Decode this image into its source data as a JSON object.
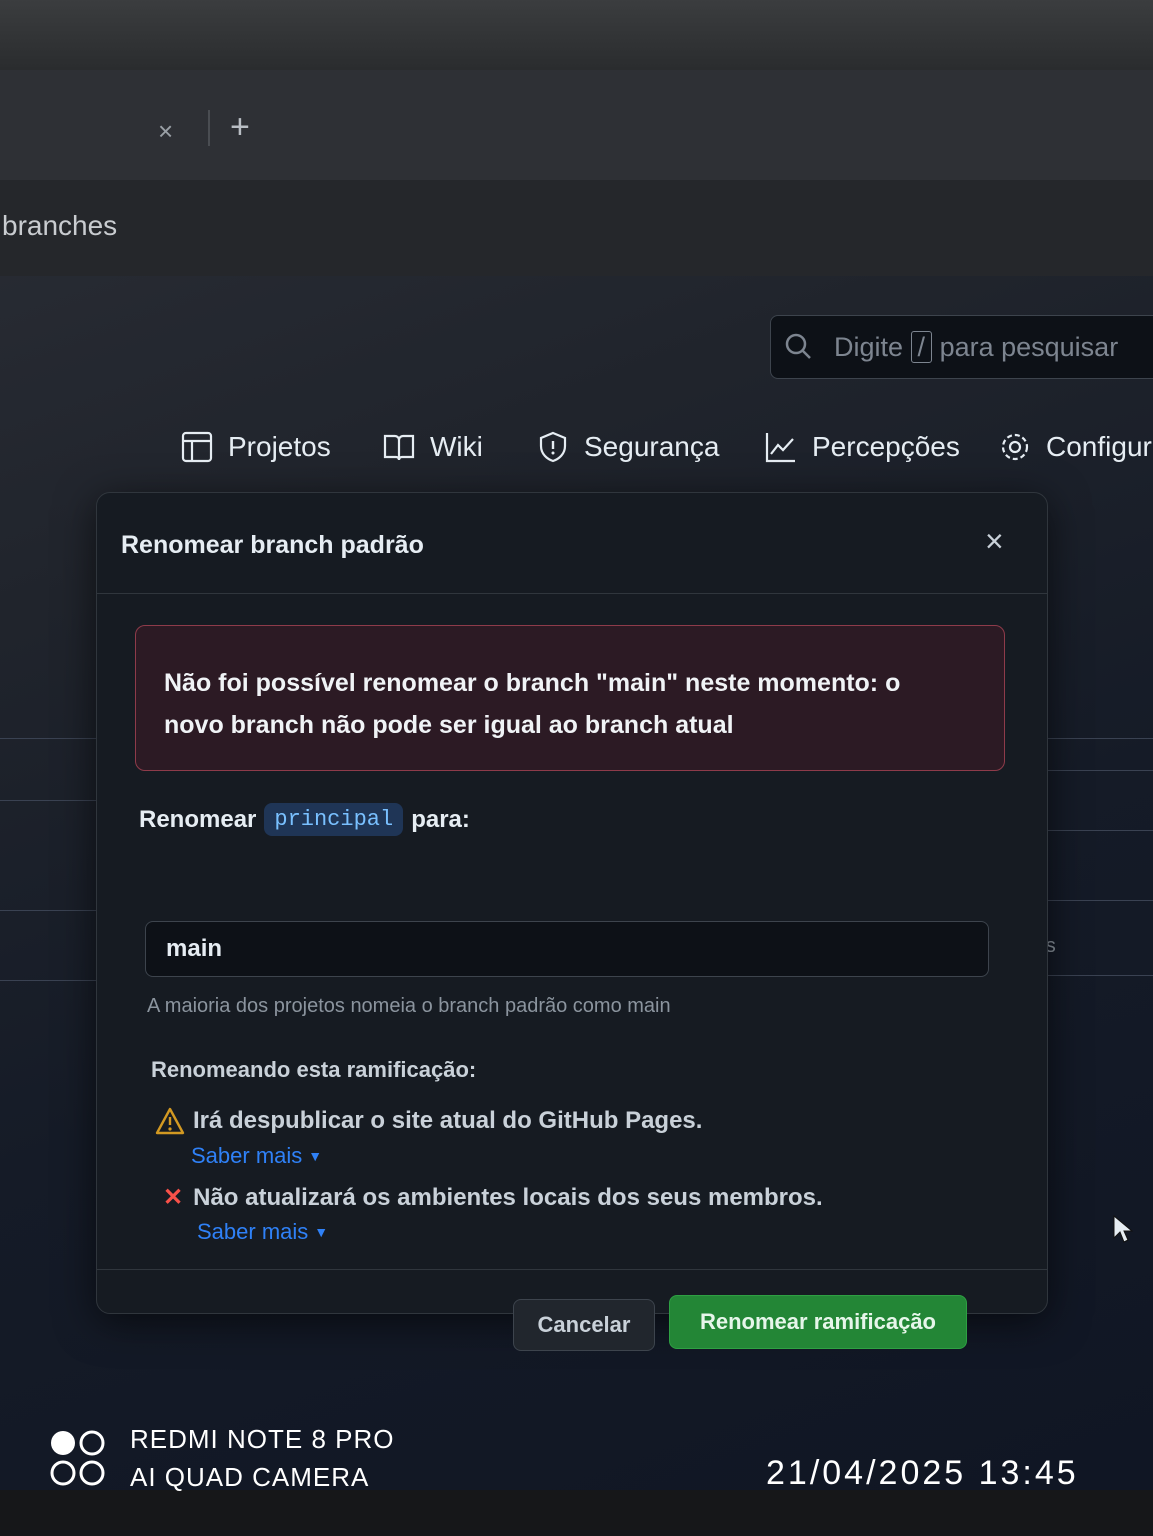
{
  "browser": {
    "tab_close_glyph": "×",
    "new_tab_glyph": "+",
    "url_fragment": "branches"
  },
  "header": {
    "search": {
      "before": "Digite",
      "key": "/",
      "after": "para pesquisar"
    }
  },
  "nav": {
    "items": [
      {
        "label": "Projetos",
        "icon": "table-icon"
      },
      {
        "label": "Wiki",
        "icon": "book-icon"
      },
      {
        "label": "Segurança",
        "icon": "shield-icon"
      },
      {
        "label": "Percepções",
        "icon": "graph-icon"
      },
      {
        "label": "Configur",
        "icon": "gear-icon"
      }
    ]
  },
  "background": {
    "status_fragment": "atus"
  },
  "dialog": {
    "title": "Renomear branch padrão",
    "close_glyph": "×",
    "error": "Não foi possível renomear o branch \"main\" neste momento: o novo branch não pode ser igual ao branch atual",
    "rename_prefix": "Renomear",
    "branch_name": "principal",
    "rename_suffix": "para:",
    "input_value": "main",
    "hint": "A maioria dos projetos nomeia o branch padrão como main",
    "consequences_heading": "Renomeando esta ramificação:",
    "warning_text": "Irá despublicar o site atual do GitHub Pages.",
    "info_text": "Não atualizará os ambientes locais dos seus membros.",
    "learn_more": "Saber mais",
    "cancel_label": "Cancelar",
    "confirm_label": "Renomear ramificação"
  },
  "camera": {
    "model": "REDMI NOTE 8 PRO",
    "subtitle": "AI QUAD CAMERA",
    "datetime": "21/04/2025 13:45"
  },
  "colors": {
    "error_border": "#8e3b4a",
    "error_bg": "#2c1a24",
    "primary_button": "#238636",
    "link": "#2f81f7",
    "danger": "#f85149",
    "warning": "#d29922"
  }
}
